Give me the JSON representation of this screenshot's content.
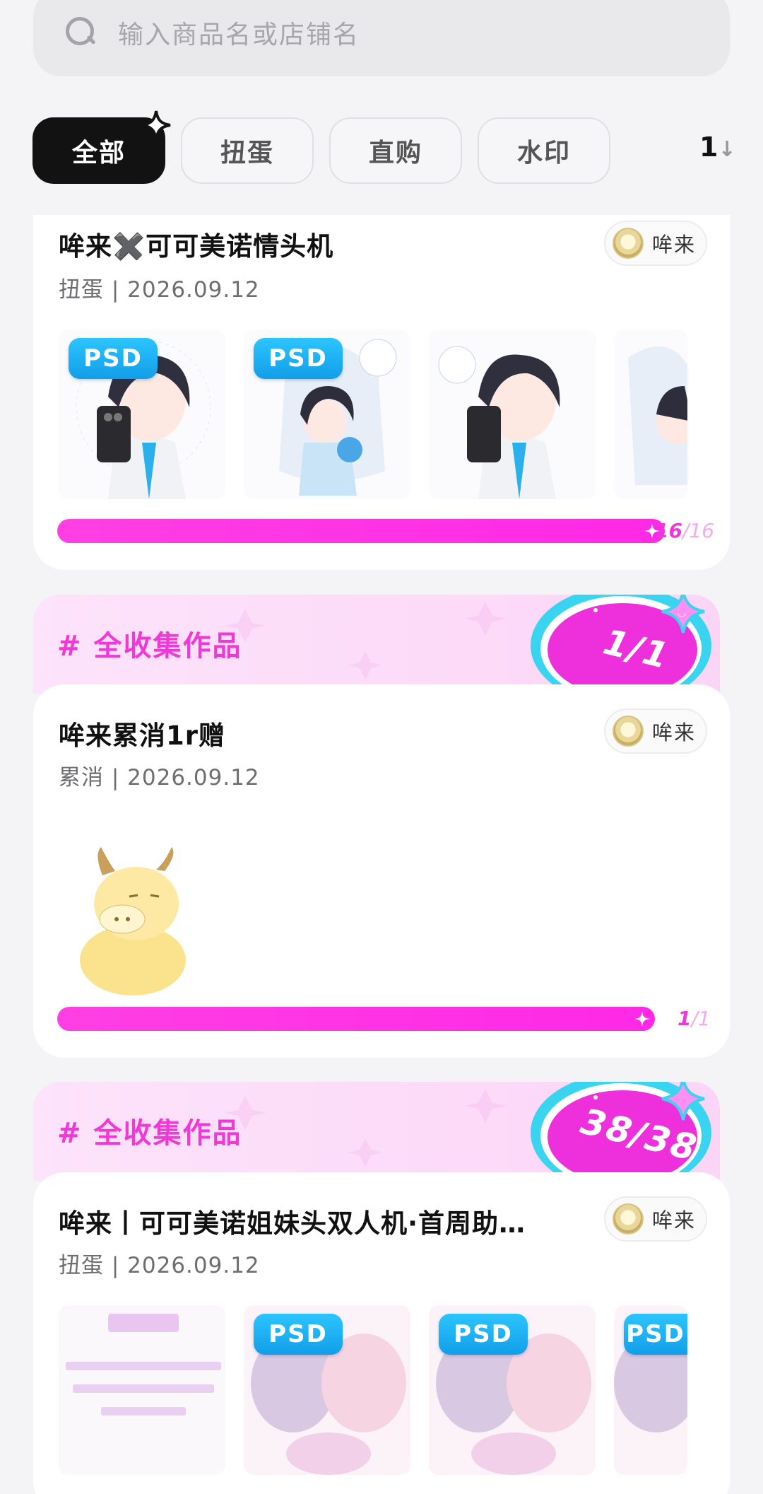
{
  "search": {
    "placeholder": "输入商品名或店铺名"
  },
  "tabs": [
    {
      "label": "全部",
      "active": true
    },
    {
      "label": "扭蛋",
      "active": false
    },
    {
      "label": "直购",
      "active": false
    },
    {
      "label": "水印",
      "active": false
    }
  ],
  "tab_more_label": "1",
  "cards": [
    {
      "title": "哞来✖️可可美诺情头机",
      "meta": "扭蛋 | 2026.09.12",
      "shop": "哞来",
      "thumb_badge": "PSD",
      "progress": {
        "collected": "16",
        "total": "16",
        "fraction": 1.0
      }
    },
    {
      "banner": "# 全收集作品",
      "badge": "1/1",
      "title": "哞来累消1r赠",
      "meta": "累消 | 2026.09.12",
      "shop": "哞来",
      "progress": {
        "collected": "1",
        "total": "1",
        "fraction": 1.0
      }
    },
    {
      "banner": "# 全收集作品",
      "badge": "38/38",
      "title": "哞来丨可可美诺姐妹头双人机·首周助…",
      "meta": "扭蛋 | 2026.09.12",
      "shop": "哞来",
      "thumb_badge": "PSD"
    }
  ],
  "colors": {
    "accent": "#ff2ee6",
    "psd_badge": "#1aaef0",
    "active_tab": "#121212"
  }
}
